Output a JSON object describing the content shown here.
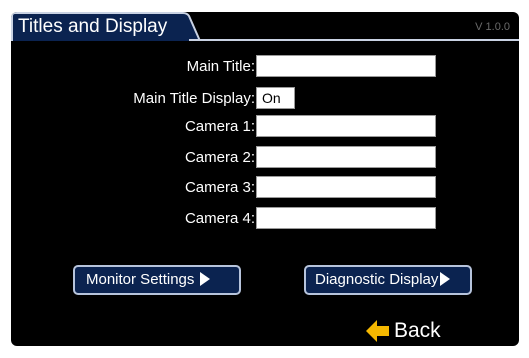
{
  "header": {
    "title": "Titles and Display",
    "version": "V 1.0.0"
  },
  "form": {
    "main_title": {
      "label": "Main Title:",
      "value": ""
    },
    "main_title_display": {
      "label": "Main Title Display:",
      "value": "On"
    },
    "camera1": {
      "label": "Camera 1:",
      "value": ""
    },
    "camera2": {
      "label": "Camera 2:",
      "value": ""
    },
    "camera3": {
      "label": "Camera 3:",
      "value": ""
    },
    "camera4": {
      "label": "Camera 4:",
      "value": ""
    }
  },
  "buttons": {
    "monitor_settings": "Monitor Settings",
    "diagnostic_display": "Diagnostic Display",
    "back": "Back"
  },
  "colors": {
    "background": "#000000",
    "tab_fill": "#0b2350",
    "tab_border": "#c9d2e3",
    "button_fill": "#0b2350",
    "back_arrow": "#f5b800"
  },
  "icons": {
    "monitor_arrow": "play-arrow-icon",
    "diagnostic_arrow": "play-arrow-icon",
    "back": "back-arrow-icon"
  }
}
